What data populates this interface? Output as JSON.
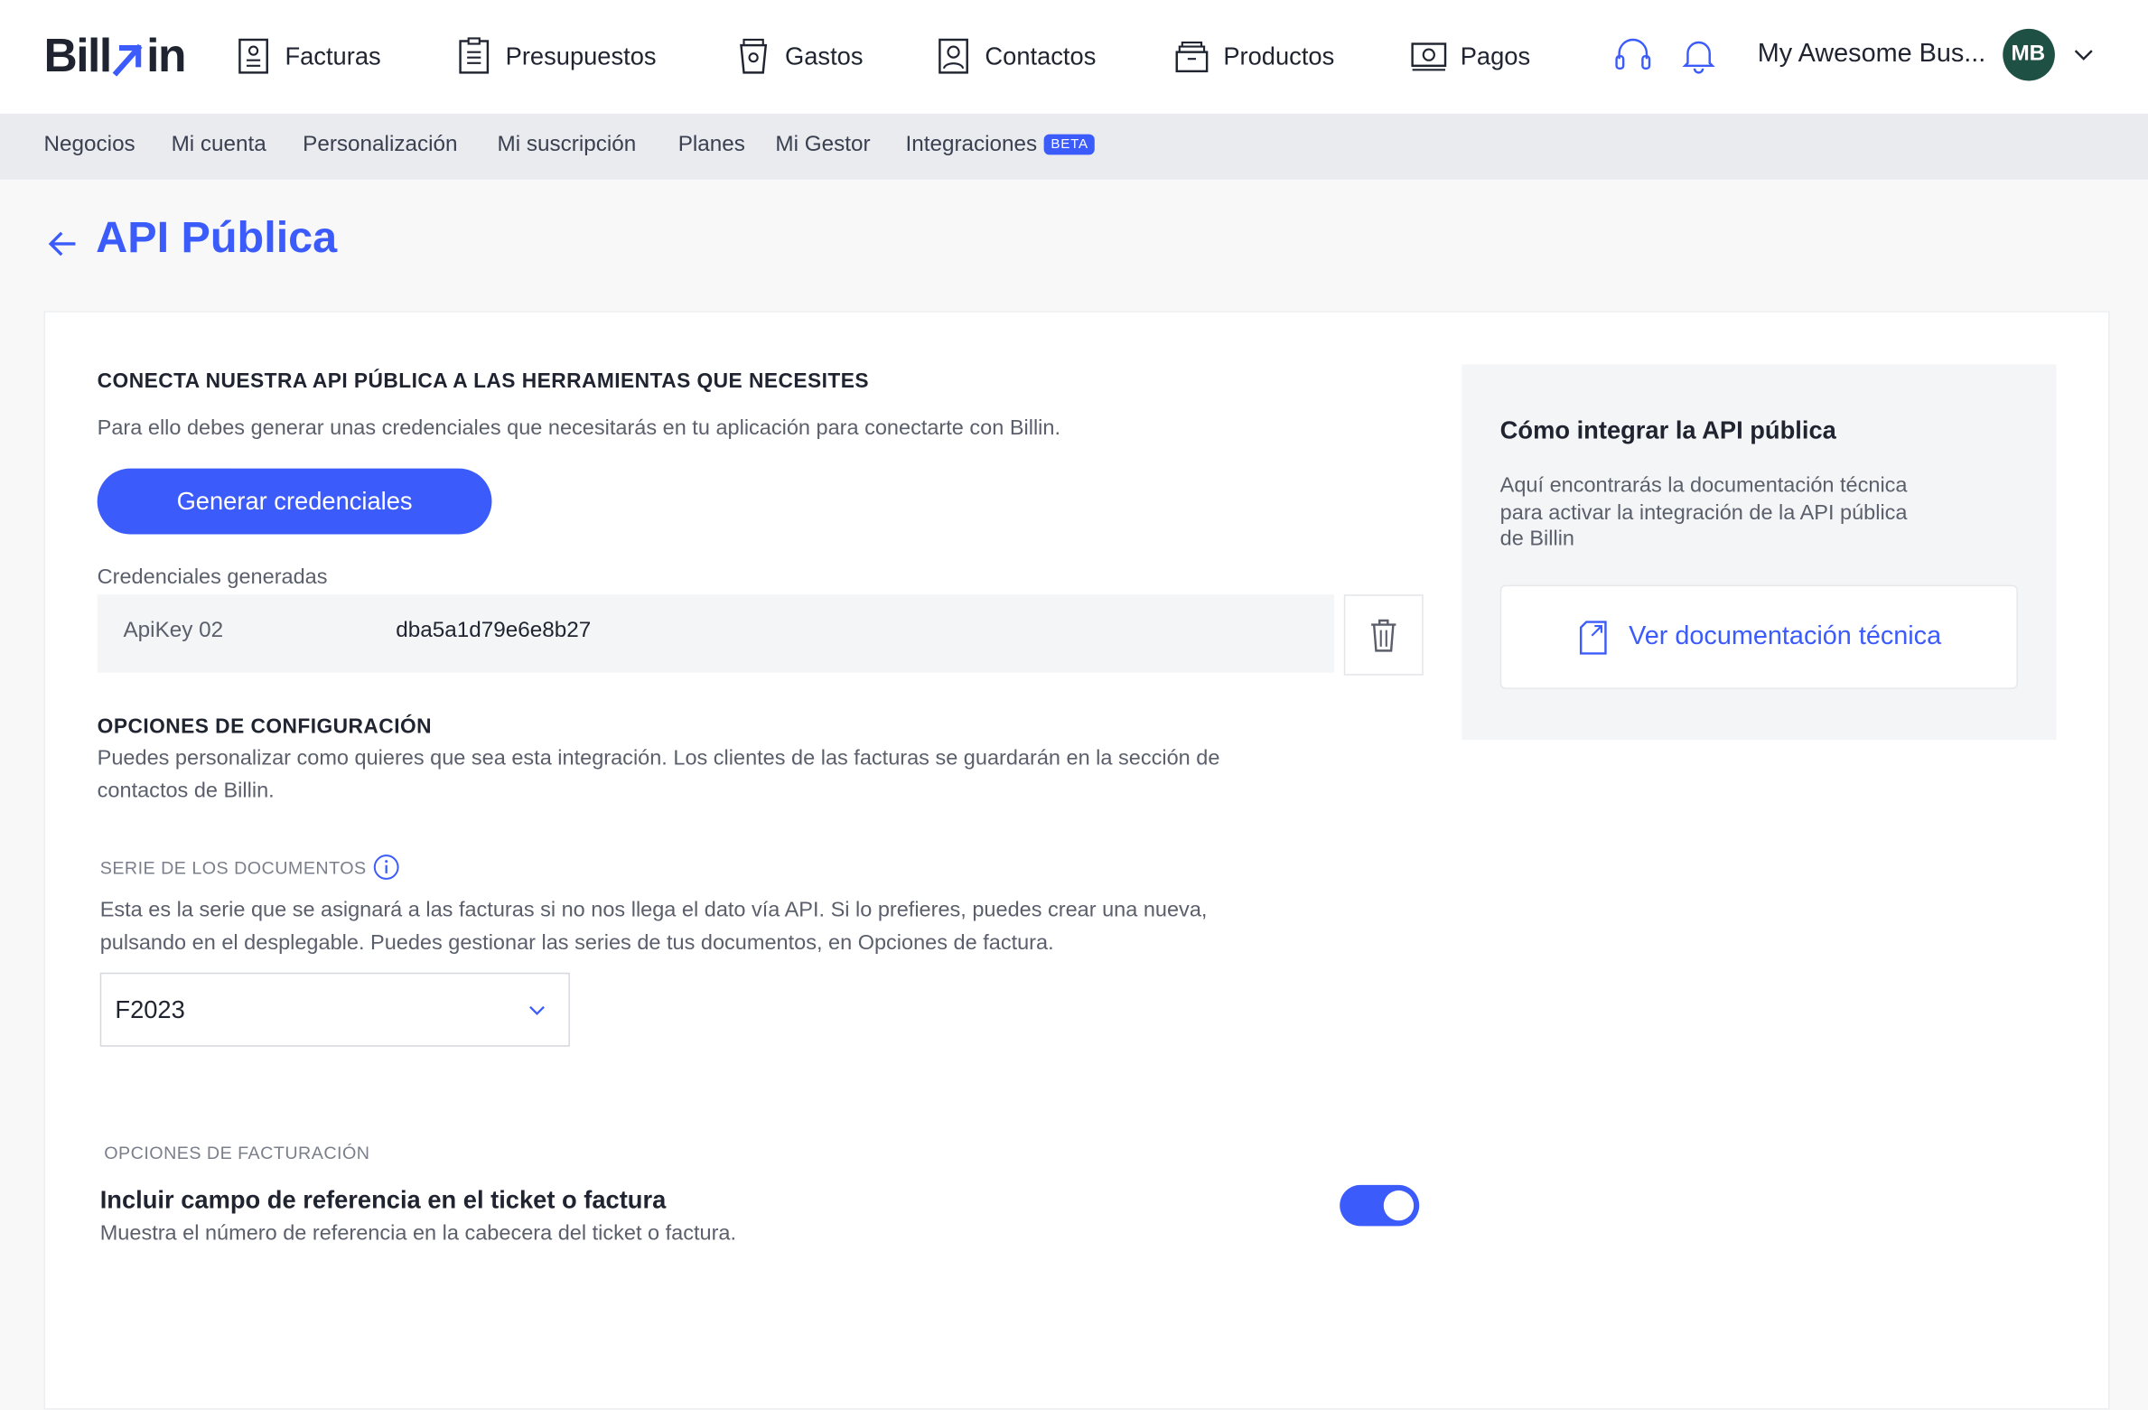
{
  "brand": {
    "logo_main": "Bill",
    "logo_accent": "in",
    "accent_color": "#3b5bfb"
  },
  "nav": [
    {
      "label": "Facturas",
      "icon": "invoice-icon"
    },
    {
      "label": "Presupuestos",
      "icon": "estimate-icon"
    },
    {
      "label": "Gastos",
      "icon": "expense-cup-icon"
    },
    {
      "label": "Contactos",
      "icon": "contacts-icon"
    },
    {
      "label": "Productos",
      "icon": "products-box-icon"
    },
    {
      "label": "Pagos",
      "icon": "payments-icon"
    }
  ],
  "account": {
    "name": "My Awesome Bus...",
    "initials": "MB",
    "avatar_color": "#1f5044"
  },
  "subnav": [
    {
      "label": "Negocios"
    },
    {
      "label": "Mi cuenta"
    },
    {
      "label": "Personalización"
    },
    {
      "label": "Mi suscripción"
    },
    {
      "label": "Planes"
    },
    {
      "label": "Mi Gestor"
    },
    {
      "label": "Integraciones",
      "badge": "BETA"
    }
  ],
  "page": {
    "title": "API Pública"
  },
  "connect": {
    "heading": "CONECTA NUESTRA API PÚBLICA A LAS HERRAMIENTAS QUE NECESITES",
    "description": "Para ello debes generar unas credenciales que necesitarás en tu aplicación para conectarte con Billin.",
    "generate_button": "Generar credenciales",
    "credentials_label": "Credenciales generadas",
    "credential": {
      "name": "ApiKey 02",
      "value": "dba5a1d79e6e8b27"
    }
  },
  "config": {
    "heading": "OPCIONES DE CONFIGURACIÓN",
    "description_line1": "Puedes personalizar como quieres que sea esta integración. Los clientes de las facturas se guardarán en la sección de",
    "description_line2": "contactos de Billin.",
    "series_label": "SERIE DE LOS DOCUMENTOS",
    "series_help_line1": "Esta es la serie que se asignará a las facturas si no nos llega el dato vía API. Si lo prefieres, puedes crear una nueva,",
    "series_help_line2": "pulsando en el desplegable. Puedes gestionar las series de tus documentos, en Opciones de factura.",
    "series_value": "F2023"
  },
  "billing": {
    "label": "OPCIONES DE FACTURACIÓN",
    "option_title": "Incluir campo de referencia en el ticket o factura",
    "option_description": "Muestra el número de referencia en la cabecera del ticket o factura.",
    "option_enabled": true
  },
  "side": {
    "title": "Cómo integrar la API pública",
    "description_line1": "Aquí encontrarás la documentación técnica",
    "description_line2": "para activar la integración de la API pública",
    "description_line3": "de Billin",
    "link_label": "Ver documentación técnica"
  }
}
